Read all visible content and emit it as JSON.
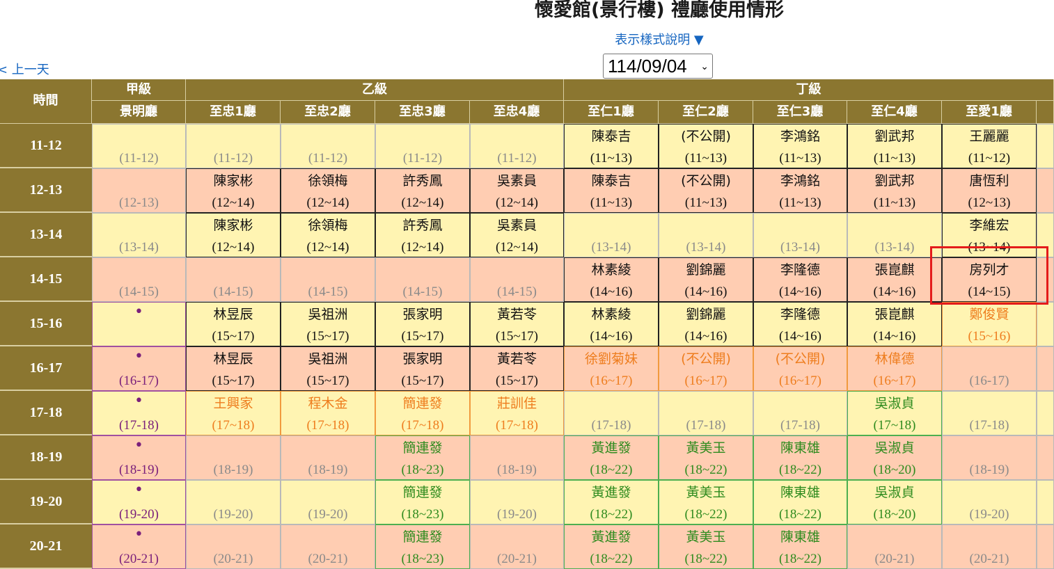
{
  "header": {
    "title": "懷愛館(景行樓) 禮廳使用情形",
    "legend_link": "表示樣式說明 ▼",
    "prev_day": "< 上一天",
    "date_value": "114/09/04",
    "chevron": "⌄"
  },
  "table": {
    "time_header": "時間",
    "groups": [
      "甲級",
      "乙級",
      "丁級"
    ],
    "rooms": [
      "景明廳",
      "至忠1廳",
      "至忠2廳",
      "至忠3廳",
      "至忠4廳",
      "至仁1廳",
      "至仁2廳",
      "至仁3廳",
      "至仁4廳",
      "至愛1廳"
    ],
    "rows": [
      {
        "time": "11-12",
        "cells": [
          {
            "n": "",
            "r": "(11-12)",
            "bg": "yel",
            "c": "gray"
          },
          {
            "n": "",
            "r": "(11-12)",
            "bg": "yel",
            "c": "gray"
          },
          {
            "n": "",
            "r": "(11-12)",
            "bg": "yel",
            "c": "gray"
          },
          {
            "n": "",
            "r": "(11-12)",
            "bg": "yel",
            "c": "gray"
          },
          {
            "n": "",
            "r": "(11-12)",
            "bg": "yel",
            "c": "gray"
          },
          {
            "n": "陳泰吉",
            "r": "(11~13)",
            "bg": "yel",
            "c": "black",
            "b": "black"
          },
          {
            "n": "(不公開)",
            "r": "(11~13)",
            "bg": "yel",
            "c": "black",
            "b": "black"
          },
          {
            "n": "李鴻銘",
            "r": "(11~13)",
            "bg": "yel",
            "c": "black",
            "b": "black"
          },
          {
            "n": "劉武邦",
            "r": "(11~13)",
            "bg": "yel",
            "c": "black",
            "b": "black"
          },
          {
            "n": "王麗麗",
            "r": "(11~12)",
            "bg": "yel",
            "c": "black",
            "b": "black"
          }
        ]
      },
      {
        "time": "12-13",
        "cells": [
          {
            "n": "",
            "r": "(12-13)",
            "bg": "pch",
            "c": "gray"
          },
          {
            "n": "陳家彬",
            "r": "(12~14)",
            "bg": "pch",
            "c": "black",
            "b": "black"
          },
          {
            "n": "徐領梅",
            "r": "(12~14)",
            "bg": "pch",
            "c": "black",
            "b": "black"
          },
          {
            "n": "許秀鳳",
            "r": "(12~14)",
            "bg": "pch",
            "c": "black",
            "b": "black"
          },
          {
            "n": "吳素員",
            "r": "(12~14)",
            "bg": "pch",
            "c": "black",
            "b": "black"
          },
          {
            "n": "陳泰吉",
            "r": "(11~13)",
            "bg": "pch",
            "c": "black",
            "b": "black"
          },
          {
            "n": "(不公開)",
            "r": "(11~13)",
            "bg": "pch",
            "c": "black",
            "b": "black"
          },
          {
            "n": "李鴻銘",
            "r": "(11~13)",
            "bg": "pch",
            "c": "black",
            "b": "black"
          },
          {
            "n": "劉武邦",
            "r": "(11~13)",
            "bg": "pch",
            "c": "black",
            "b": "black"
          },
          {
            "n": "唐恆利",
            "r": "(12~13)",
            "bg": "pch",
            "c": "black",
            "b": "black"
          }
        ]
      },
      {
        "time": "13-14",
        "cells": [
          {
            "n": "",
            "r": "(13-14)",
            "bg": "yel",
            "c": "gray"
          },
          {
            "n": "陳家彬",
            "r": "(12~14)",
            "bg": "yel",
            "c": "black",
            "b": "black"
          },
          {
            "n": "徐領梅",
            "r": "(12~14)",
            "bg": "yel",
            "c": "black",
            "b": "black"
          },
          {
            "n": "許秀鳳",
            "r": "(12~14)",
            "bg": "yel",
            "c": "black",
            "b": "black"
          },
          {
            "n": "吳素員",
            "r": "(12~14)",
            "bg": "yel",
            "c": "black",
            "b": "black"
          },
          {
            "n": "",
            "r": "(13-14)",
            "bg": "yel",
            "c": "gray"
          },
          {
            "n": "",
            "r": "(13-14)",
            "bg": "yel",
            "c": "gray"
          },
          {
            "n": "",
            "r": "(13-14)",
            "bg": "yel",
            "c": "gray"
          },
          {
            "n": "",
            "r": "(13-14)",
            "bg": "yel",
            "c": "gray"
          },
          {
            "n": "李維宏",
            "r": "(13~14)",
            "bg": "yel",
            "c": "black",
            "b": "black"
          }
        ]
      },
      {
        "time": "14-15",
        "cells": [
          {
            "n": "",
            "r": "(14-15)",
            "bg": "pch",
            "c": "gray"
          },
          {
            "n": "",
            "r": "(14-15)",
            "bg": "pch",
            "c": "gray"
          },
          {
            "n": "",
            "r": "(14-15)",
            "bg": "pch",
            "c": "gray"
          },
          {
            "n": "",
            "r": "(14-15)",
            "bg": "pch",
            "c": "gray"
          },
          {
            "n": "",
            "r": "(14-15)",
            "bg": "pch",
            "c": "gray"
          },
          {
            "n": "林素綾",
            "r": "(14~16)",
            "bg": "pch",
            "c": "black",
            "b": "black"
          },
          {
            "n": "劉錦麗",
            "r": "(14~16)",
            "bg": "pch",
            "c": "black",
            "b": "black"
          },
          {
            "n": "李隆德",
            "r": "(14~16)",
            "bg": "pch",
            "c": "black",
            "b": "black"
          },
          {
            "n": "張崑麒",
            "r": "(14~16)",
            "bg": "pch",
            "c": "black",
            "b": "black"
          },
          {
            "n": "房列才",
            "r": "(14~15)",
            "bg": "pch",
            "c": "black",
            "b": "black"
          }
        ]
      },
      {
        "time": "15-16",
        "cells": [
          {
            "n": "•",
            "r": "",
            "bg": "yel",
            "c": "purple",
            "b": "purple",
            "dot": true
          },
          {
            "n": "林昱辰",
            "r": "(15~17)",
            "bg": "yel",
            "c": "black",
            "b": "black"
          },
          {
            "n": "吳祖洲",
            "r": "(15~17)",
            "bg": "yel",
            "c": "black",
            "b": "black"
          },
          {
            "n": "張家明",
            "r": "(15~17)",
            "bg": "yel",
            "c": "black",
            "b": "black"
          },
          {
            "n": "黃若苓",
            "r": "(15~17)",
            "bg": "yel",
            "c": "black",
            "b": "black"
          },
          {
            "n": "林素綾",
            "r": "(14~16)",
            "bg": "yel",
            "c": "black",
            "b": "black"
          },
          {
            "n": "劉錦麗",
            "r": "(14~16)",
            "bg": "yel",
            "c": "black",
            "b": "black"
          },
          {
            "n": "李隆德",
            "r": "(14~16)",
            "bg": "yel",
            "c": "black",
            "b": "black"
          },
          {
            "n": "張崑麒",
            "r": "(14~16)",
            "bg": "yel",
            "c": "black",
            "b": "black"
          },
          {
            "n": "鄭俊賢",
            "r": "(15~16)",
            "bg": "yel",
            "c": "orange",
            "b": "orange"
          }
        ]
      },
      {
        "time": "16-17",
        "cells": [
          {
            "n": "•",
            "r": "(16-17)",
            "bg": "pch",
            "c": "purple",
            "b": "purple",
            "dot": true
          },
          {
            "n": "林昱辰",
            "r": "(15~17)",
            "bg": "pch",
            "c": "black",
            "b": "black"
          },
          {
            "n": "吳祖洲",
            "r": "(15~17)",
            "bg": "pch",
            "c": "black",
            "b": "black"
          },
          {
            "n": "張家明",
            "r": "(15~17)",
            "bg": "pch",
            "c": "black",
            "b": "black"
          },
          {
            "n": "黃若苓",
            "r": "(15~17)",
            "bg": "pch",
            "c": "black",
            "b": "black"
          },
          {
            "n": "徐劉菊妹",
            "r": "(16~17)",
            "bg": "pch",
            "c": "orange",
            "b": "orange"
          },
          {
            "n": "(不公開)",
            "r": "(16~17)",
            "bg": "pch",
            "c": "orange",
            "b": "orange"
          },
          {
            "n": "(不公開)",
            "r": "(16~17)",
            "bg": "pch",
            "c": "orange",
            "b": "orange"
          },
          {
            "n": "林偉德",
            "r": "(16~17)",
            "bg": "pch",
            "c": "orange",
            "b": "orange"
          },
          {
            "n": "",
            "r": "(16-17)",
            "bg": "pch",
            "c": "gray"
          }
        ]
      },
      {
        "time": "17-18",
        "cells": [
          {
            "n": "•",
            "r": "(17-18)",
            "bg": "yel",
            "c": "purple",
            "b": "purple",
            "dot": true
          },
          {
            "n": "王興家",
            "r": "(17~18)",
            "bg": "yel",
            "c": "orange",
            "b": "orange"
          },
          {
            "n": "程木金",
            "r": "(17~18)",
            "bg": "yel",
            "c": "orange",
            "b": "orange"
          },
          {
            "n": "簡連發",
            "r": "(17~18)",
            "bg": "yel",
            "c": "orange",
            "b": "orange"
          },
          {
            "n": "莊訓佳",
            "r": "(17~18)",
            "bg": "yel",
            "c": "orange",
            "b": "orange"
          },
          {
            "n": "",
            "r": "(17-18)",
            "bg": "yel",
            "c": "gray"
          },
          {
            "n": "",
            "r": "(17-18)",
            "bg": "yel",
            "c": "gray"
          },
          {
            "n": "",
            "r": "(17-18)",
            "bg": "yel",
            "c": "gray"
          },
          {
            "n": "吳淑貞",
            "r": "(17~18)",
            "bg": "yel",
            "c": "green",
            "b": "green"
          },
          {
            "n": "",
            "r": "(17-18)",
            "bg": "yel",
            "c": "gray"
          }
        ]
      },
      {
        "time": "18-19",
        "cells": [
          {
            "n": "•",
            "r": "(18-19)",
            "bg": "pch",
            "c": "purple",
            "b": "purple",
            "dot": true
          },
          {
            "n": "",
            "r": "(18-19)",
            "bg": "pch",
            "c": "gray"
          },
          {
            "n": "",
            "r": "(18-19)",
            "bg": "pch",
            "c": "gray"
          },
          {
            "n": "簡連發",
            "r": "(18~23)",
            "bg": "pch",
            "c": "green",
            "b": "green"
          },
          {
            "n": "",
            "r": "(18-19)",
            "bg": "pch",
            "c": "gray"
          },
          {
            "n": "黃進發",
            "r": "(18~22)",
            "bg": "pch",
            "c": "green",
            "b": "green"
          },
          {
            "n": "黃美玉",
            "r": "(18~22)",
            "bg": "pch",
            "c": "green",
            "b": "green"
          },
          {
            "n": "陳東雄",
            "r": "(18~22)",
            "bg": "pch",
            "c": "green",
            "b": "green"
          },
          {
            "n": "吳淑貞",
            "r": "(18~20)",
            "bg": "pch",
            "c": "green",
            "b": "green"
          },
          {
            "n": "",
            "r": "(18-19)",
            "bg": "pch",
            "c": "gray"
          }
        ]
      },
      {
        "time": "19-20",
        "cells": [
          {
            "n": "•",
            "r": "(19-20)",
            "bg": "yel",
            "c": "purple",
            "b": "purple",
            "dot": true
          },
          {
            "n": "",
            "r": "(19-20)",
            "bg": "yel",
            "c": "gray"
          },
          {
            "n": "",
            "r": "(19-20)",
            "bg": "yel",
            "c": "gray"
          },
          {
            "n": "簡連發",
            "r": "(18~23)",
            "bg": "yel",
            "c": "green",
            "b": "green"
          },
          {
            "n": "",
            "r": "(19-20)",
            "bg": "yel",
            "c": "gray"
          },
          {
            "n": "黃進發",
            "r": "(18~22)",
            "bg": "yel",
            "c": "green",
            "b": "green"
          },
          {
            "n": "黃美玉",
            "r": "(18~22)",
            "bg": "yel",
            "c": "green",
            "b": "green"
          },
          {
            "n": "陳東雄",
            "r": "(18~22)",
            "bg": "yel",
            "c": "green",
            "b": "green"
          },
          {
            "n": "吳淑貞",
            "r": "(18~20)",
            "bg": "yel",
            "c": "green",
            "b": "green"
          },
          {
            "n": "",
            "r": "(19-20)",
            "bg": "yel",
            "c": "gray"
          }
        ]
      },
      {
        "time": "20-21",
        "cells": [
          {
            "n": "•",
            "r": "(20-21)",
            "bg": "pch",
            "c": "purple",
            "b": "purple",
            "dot": true
          },
          {
            "n": "",
            "r": "(20-21)",
            "bg": "pch",
            "c": "gray"
          },
          {
            "n": "",
            "r": "(20-21)",
            "bg": "pch",
            "c": "gray"
          },
          {
            "n": "簡連發",
            "r": "(18~23)",
            "bg": "pch",
            "c": "green",
            "b": "green"
          },
          {
            "n": "",
            "r": "(20-21)",
            "bg": "pch",
            "c": "gray"
          },
          {
            "n": "黃進發",
            "r": "(18~22)",
            "bg": "pch",
            "c": "green",
            "b": "green"
          },
          {
            "n": "黃美玉",
            "r": "(18~22)",
            "bg": "pch",
            "c": "green",
            "b": "green"
          },
          {
            "n": "陳東雄",
            "r": "(18~22)",
            "bg": "pch",
            "c": "green",
            "b": "green"
          },
          {
            "n": "",
            "r": "(20-21)",
            "bg": "pch",
            "c": "gray"
          },
          {
            "n": "",
            "r": "(20-21)",
            "bg": "pch",
            "c": "gray"
          }
        ]
      }
    ]
  }
}
